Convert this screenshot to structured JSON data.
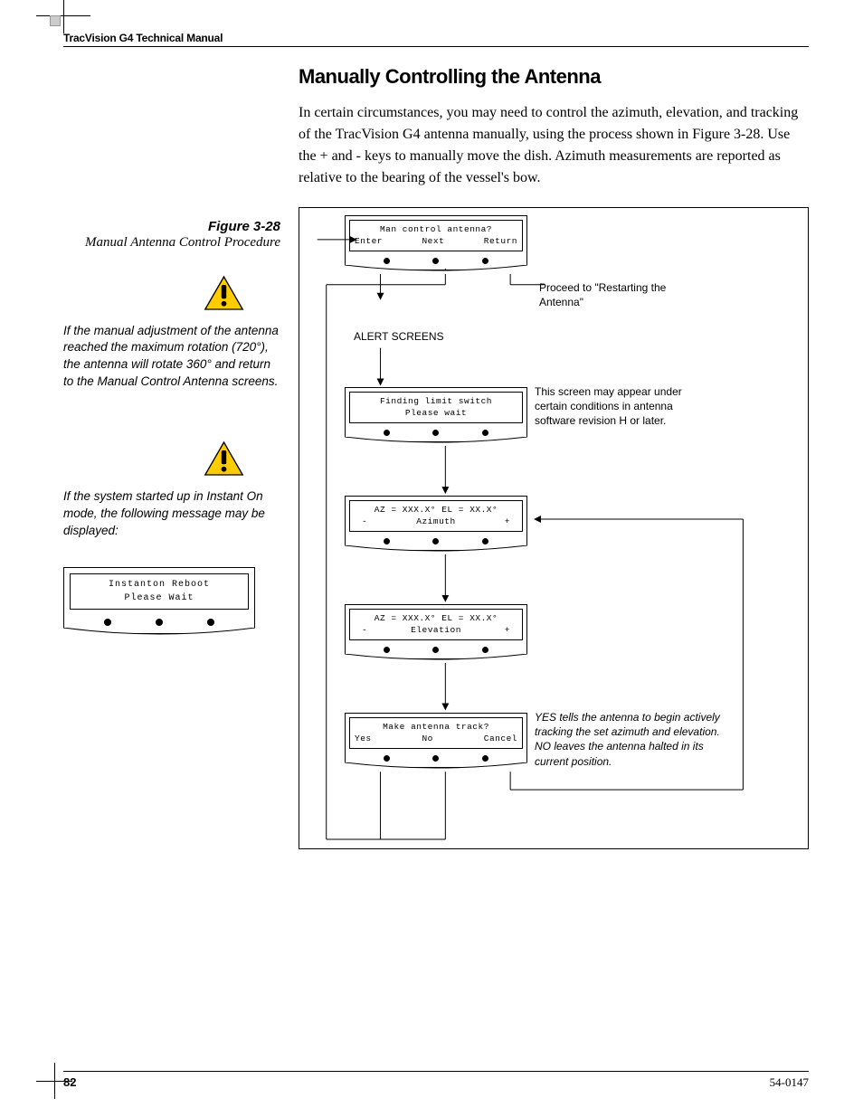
{
  "header": "TracVision G4 Technical Manual",
  "title": "Manually Controlling the Antenna",
  "body": "In certain circumstances, you may need to control the azimuth, elevation, and tracking of the TracVision G4 antenna manually, using the process shown in Figure 3-28. Use the + and - keys to manually move the dish. Azimuth measurements are reported as relative to the bearing of the vessel's bow.",
  "figure": {
    "label": "Figure 3-28",
    "caption": "Manual Antenna Control Procedure"
  },
  "warning1": "If the manual adjustment of the antenna reached the maximum rotation (720°), the antenna will rotate 360° and return to the Manual Control Antenna screens.",
  "warning2": "If the system started up in Instant On mode, the following message may be displayed:",
  "instanton": {
    "line1": "Instanton Reboot",
    "line2": "Please Wait"
  },
  "flow": {
    "box1": {
      "line1": "Man control antenna?",
      "opt1": "Enter",
      "opt2": "Next",
      "opt3": "Return"
    },
    "alert_label": "ALERT SCREENS",
    "note1": "Proceed to \"Restarting the Antenna\"",
    "box2": {
      "line1": "Finding limit switch",
      "line2": "Please wait"
    },
    "note2": "This screen may appear under certain conditions in antenna software revision H or later.",
    "box3": {
      "line1": "AZ = XXX.X°  EL = XX.X°",
      "opt1": "-",
      "opt2": "Azimuth",
      "opt3": "+"
    },
    "box4": {
      "line1": "AZ = XXX.X°  EL = XX.X°",
      "opt1": "-",
      "opt2": "Elevation",
      "opt3": "+"
    },
    "box5": {
      "line1": "Make antenna track?",
      "opt1": "Yes",
      "opt2": "No",
      "opt3": "Cancel"
    },
    "note3": "YES tells the antenna to begin actively tracking the set azimuth and elevation. NO leaves the antenna halted in its current position."
  },
  "footer": {
    "page": "82",
    "doc": "54-0147"
  }
}
